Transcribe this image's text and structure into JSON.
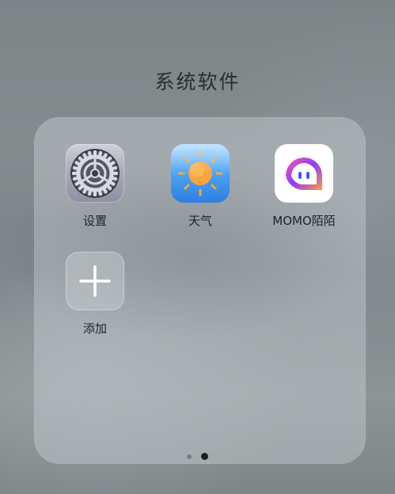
{
  "folder": {
    "title": "系统软件"
  },
  "apps": [
    {
      "label": "设置",
      "icon": "gear-icon"
    },
    {
      "label": "天气",
      "icon": "sun-icon"
    },
    {
      "label": "MOMO陌陌",
      "icon": "momo-logo-icon"
    },
    {
      "label": "添加",
      "icon": "plus-icon"
    }
  ],
  "pagination": {
    "pages": 2,
    "current_page": 2
  },
  "colors": {
    "weather_blue": "#4fa6f5",
    "sun_orange": "#f6a53a",
    "momo_gradient_start": "#8a3cff",
    "momo_gradient_end": "#ff5a7a"
  }
}
